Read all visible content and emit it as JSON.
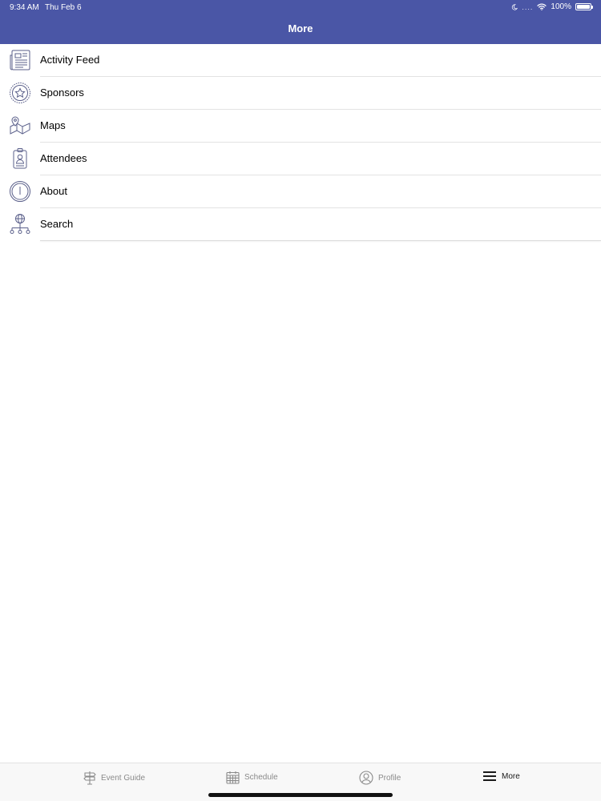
{
  "status_bar": {
    "time": "9:34 AM",
    "date": "Thu Feb 6",
    "battery": "100%"
  },
  "nav": {
    "title": "More"
  },
  "menu": {
    "items": [
      {
        "label": "Activity Feed",
        "icon": "newspaper-icon"
      },
      {
        "label": "Sponsors",
        "icon": "star-badge-icon"
      },
      {
        "label": "Maps",
        "icon": "map-icon"
      },
      {
        "label": "Attendees",
        "icon": "id-badge-icon"
      },
      {
        "label": "About",
        "icon": "info-icon"
      },
      {
        "label": "Search",
        "icon": "network-globe-icon"
      }
    ]
  },
  "tabs": [
    {
      "label": "Event Guide",
      "icon": "signpost-icon"
    },
    {
      "label": "Schedule",
      "icon": "calendar-icon"
    },
    {
      "label": "Profile",
      "icon": "person-circle-icon"
    },
    {
      "label": "More",
      "icon": "hamburger-icon",
      "active": true
    }
  ],
  "colors": {
    "header_bg": "#4a56a6",
    "icon_stroke": "#5a5f8a",
    "tab_inactive": "#8a8a8a",
    "tab_active": "#1a1a1a"
  }
}
